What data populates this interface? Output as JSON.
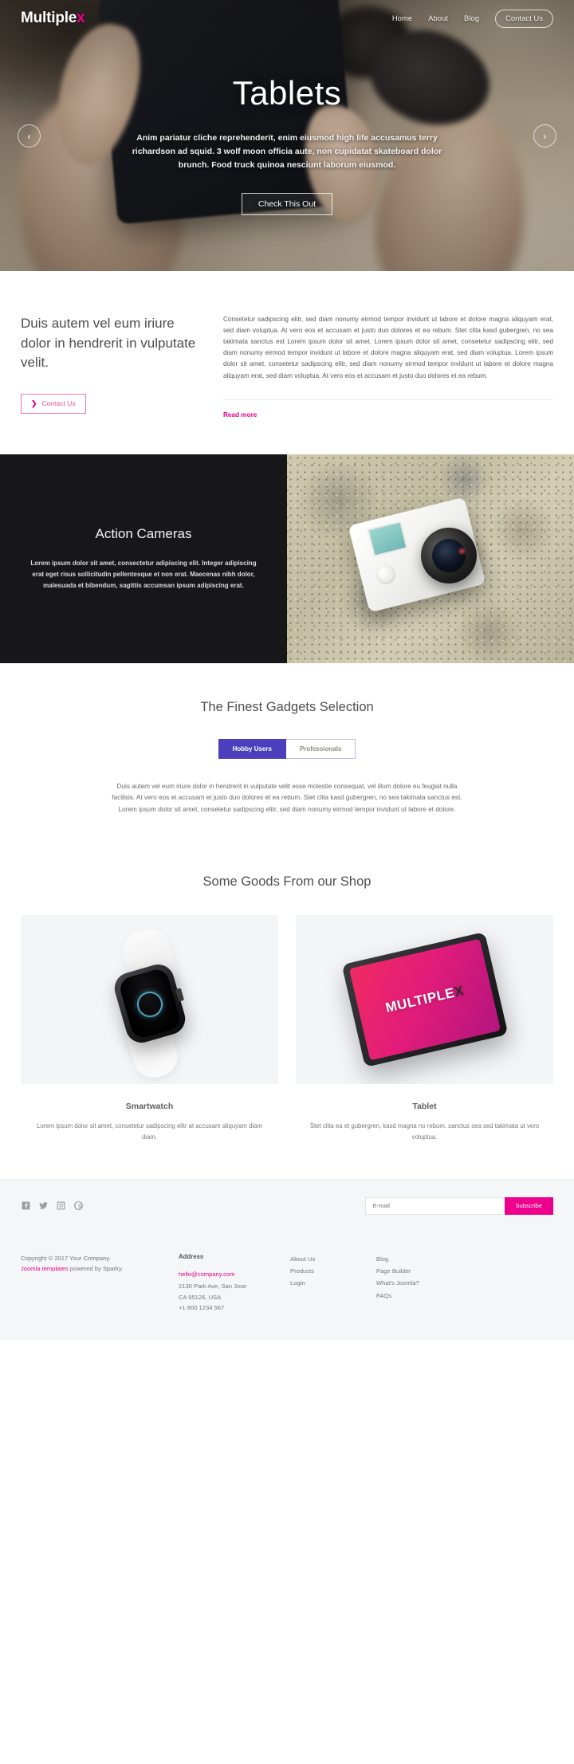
{
  "header": {
    "brand_main": "Multiple",
    "brand_accent": "x",
    "nav": [
      {
        "label": "Home"
      },
      {
        "label": "About"
      },
      {
        "label": "Blog"
      }
    ],
    "cta_label": "Contact Us"
  },
  "hero": {
    "title": "Tablets",
    "text": "Anim pariatur cliche reprehenderit, enim eiusmod high life accusamus terry richardson ad squid. 3 wolf moon officia aute, non cupidatat skateboard dolor brunch. Food truck quinoa nesciunt laborum eiusmod.",
    "button_label": "Check This Out",
    "prev_icon": "chevron-left-icon",
    "next_icon": "chevron-right-icon",
    "prev_glyph": "‹",
    "next_glyph": "›"
  },
  "intro": {
    "heading": "Duis autem vel eum iriure dolor in hendrerit in vulputate velit.",
    "button_label": "Contact Us",
    "button_chevron": "❯",
    "body": "Consetetur sadipscing elitr, sed diam nonumy eirmod tempor invidunt ut labore et dolore magna aliquyam erat, sed diam voluptua. At vero eos et accusam et justo duo dolores et ea rebum. Stet clita kasd gubergren, no sea takimata sanctus est Lorem ipsum dolor sit amet. Lorem ipsum dolor sit amet, consetetur sadipscing elitr, sed diam nonumy eirmod tempor invidunt ut labore et dolore magna aliquyam erat, sed diam voluptua. Lorem ipsum dolor sit amet, consetetur sadipscing elitr, sed diam nonumy eirmod tempor invidunt ut labore et dolore magna aliquyam erat, sed diam voluptua. At vero eos et accusam et justo duo dolores et ea rebum.",
    "read_more": "Read more"
  },
  "feature": {
    "title": "Action Cameras",
    "text": "Lorem ipsum dolor sit amet, consectetur adipiscing elit. Integer adipiscing erat eget risus sollicitudin pellentesque et non erat. Maecenas nibh dolor, malesuada et bibendum, sagittis accumsan ipsum adipiscing erat."
  },
  "gadgets": {
    "title": "The Finest Gadgets Selection",
    "tabs": [
      {
        "label": "Hobby Users",
        "active": true
      },
      {
        "label": "Professionals",
        "active": false
      }
    ],
    "body": "Duis autem vel eum iriure dolor in hendrerit in vulputate velit esse molestie consequat, vel illum dolore eu feugiat nulla facilisis. At vero eos et accusam et justo duo dolores et ea rebum. Stet clita kasd gubergren, no sea takimata sanctus est. Lorem ipsum dolor sit amet, consetetur sadipscing elitr, sed diam nonumy eirmod tempor invidunt ut labore et dolore."
  },
  "shop": {
    "title": "Some Goods From our Shop",
    "cards": [
      {
        "title": "Smartwatch",
        "text": "Lorem ipsum dolor sit amet, consetetur sadipscing elitr at accusam aliquyam diam diam."
      },
      {
        "title": "Tablet",
        "text": "Stet clita ea et gubergren, kasd magna no rebum. sanctus sea sed takimata ut vero voluptua."
      }
    ],
    "tablet_logo_main": "MULTIPLE",
    "tablet_logo_accent": "X"
  },
  "newsletter": {
    "socials": [
      {
        "name": "facebook-icon"
      },
      {
        "name": "twitter-icon"
      },
      {
        "name": "instagram-icon"
      },
      {
        "name": "pinterest-icon"
      }
    ],
    "email_placeholder": "E-mail",
    "email_value": "",
    "subscribe_label": "Subscribe"
  },
  "footer": {
    "copyright": "Copyright © 2017 Your Company.",
    "credit_link": "Joomla templates",
    "credit_rest": " powered by Sparky.",
    "address_head": "Address",
    "address_email": "hello@company.com",
    "address_line1": "2130 Park Ave, San Jose",
    "address_line2": "CA 95126, USA",
    "address_phone": "+1 800 1234 567",
    "links_col1": [
      {
        "label": "About Us"
      },
      {
        "label": "Products"
      },
      {
        "label": "Login"
      }
    ],
    "links_col2": [
      {
        "label": "Blog"
      },
      {
        "label": "Page Builder"
      },
      {
        "label": "What's Joomla?"
      },
      {
        "label": "FAQs"
      }
    ]
  },
  "colors": {
    "accent_pink": "#ec008c",
    "tab_indigo": "#4b3fbd",
    "dark_panel": "#17171a"
  }
}
